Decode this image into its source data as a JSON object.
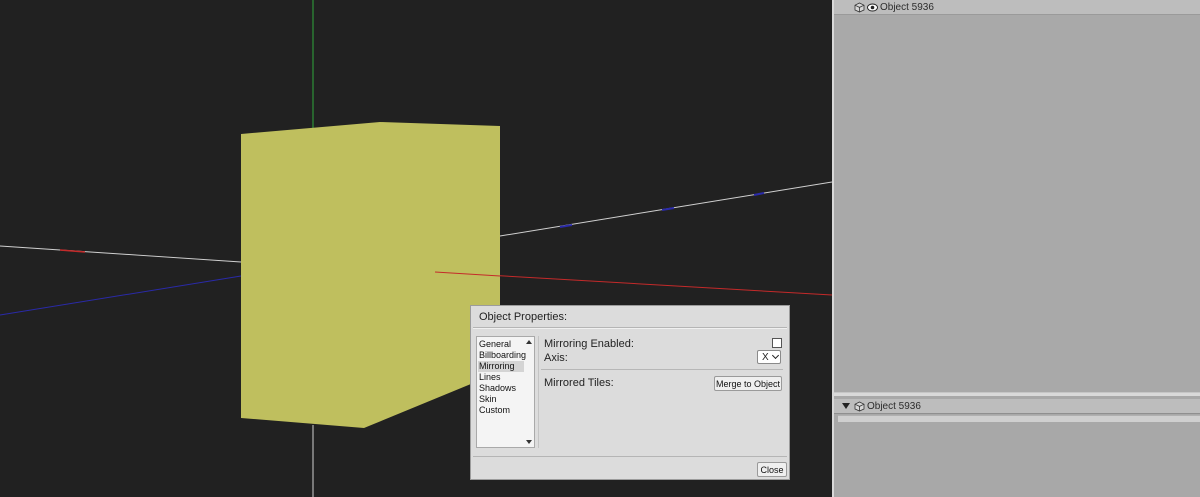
{
  "outliner": {
    "top_object_name": "Object 5936",
    "bottom_object_name": "Object 5936"
  },
  "dialog": {
    "title": "Object Properties:",
    "nav_items": [
      "General",
      "Billboarding",
      "Mirroring",
      "Lines",
      "Shadows",
      "Skin",
      "Custom"
    ],
    "selected_nav": "Mirroring",
    "mirroring_enabled_label": "Mirroring Enabled:",
    "mirroring_enabled": false,
    "axis_label": "Axis:",
    "axis_value": "X",
    "mirrored_tiles_label": "Mirrored Tiles:",
    "merge_button_label": "Merge to Object",
    "close_button_label": "Close"
  },
  "colors": {
    "viewport_bg": "#212121",
    "cube_face": "#bfbf5e",
    "axis_x": "#c42a2a",
    "axis_y": "#2ea83a",
    "axis_z": "#2a2aa8",
    "grid_line": "#d0d0d0"
  },
  "icons": {
    "object": "cube-icon",
    "visibility": "eye-icon",
    "expand": "triangle-down-icon"
  }
}
